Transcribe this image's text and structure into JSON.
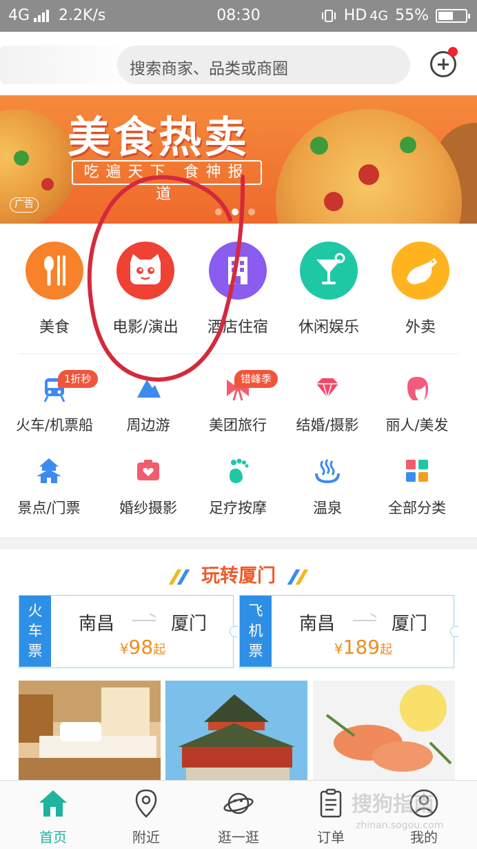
{
  "status_bar": {
    "network": "4G",
    "speed": "2.2K/s",
    "time": "08:30",
    "right_text": "HD",
    "network_right": "4G",
    "battery": "55%",
    "battery_level": 0.55
  },
  "search": {
    "placeholder": "搜索商家、品类或商圈"
  },
  "banner": {
    "title": "美食热卖",
    "subtitle": "吃遍天下 食神报道",
    "ad_label": "广告",
    "page_count": 3,
    "active_page": 2
  },
  "main_categories": [
    {
      "label": "美食",
      "icon": "fork-knife-icon",
      "color": "#f7822a"
    },
    {
      "label": "电影/演出",
      "icon": "cat-face-icon",
      "color": "#ef4134"
    },
    {
      "label": "酒店住宿",
      "icon": "building-icon",
      "color": "#8a5cf0"
    },
    {
      "label": "休闲娱乐",
      "icon": "cocktail-icon",
      "color": "#1ec8a5"
    },
    {
      "label": "外卖",
      "icon": "kangaroo-icon",
      "color": "#ffb41f"
    }
  ],
  "sub_categories": [
    {
      "label": "火车/机票船",
      "icon": "train-icon",
      "color": "#3d8bf0",
      "tag": "1折秒"
    },
    {
      "label": "周边游",
      "icon": "mountain-icon",
      "color": "#3d8bf0"
    },
    {
      "label": "美团旅行",
      "icon": "bow-icon",
      "color": "#f25c6c",
      "tag": "错峰季"
    },
    {
      "label": "结婚/摄影",
      "icon": "diamond-icon",
      "color": "#f2486a"
    },
    {
      "label": "丽人/美发",
      "icon": "woman-head-icon",
      "color": "#f25c7c"
    },
    {
      "label": "景点/门票",
      "icon": "temple-icon",
      "color": "#3d8bf0"
    },
    {
      "label": "婚纱摄影",
      "icon": "camera-icon",
      "color": "#f25c6c"
    },
    {
      "label": "足疗按摩",
      "icon": "footprint-icon",
      "color": "#1ec8a5"
    },
    {
      "label": "温泉",
      "icon": "hot-spring-icon",
      "color": "#3d8bf0"
    },
    {
      "label": "全部分类",
      "icon": "grid-icon",
      "color": "#f0a020"
    }
  ],
  "section": {
    "title": "玩转厦门"
  },
  "tickets": [
    {
      "type": "火车票",
      "from": "南昌",
      "to": "厦门",
      "currency": "¥",
      "price": "98",
      "suffix": "起"
    },
    {
      "type": "飞机票",
      "from": "南昌",
      "to": "厦门",
      "currency": "¥",
      "price": "189",
      "suffix": "起"
    }
  ],
  "bottom_nav": [
    {
      "label": "首页",
      "icon": "home-icon",
      "active": true
    },
    {
      "label": "附近",
      "icon": "location-pin-icon"
    },
    {
      "label": "逛一逛",
      "icon": "planet-icon"
    },
    {
      "label": "订单",
      "icon": "clipboard-icon"
    },
    {
      "label": "我的",
      "icon": "user-icon"
    }
  ],
  "watermark": {
    "text": "搜狗指南",
    "url_text": "zhinan.sogou.com"
  },
  "colors": {
    "accent": "#1fb3a0",
    "section_title": "#f05a2a",
    "price": "#f08c1e",
    "ticket_side": "#2e8fe6",
    "annotation": "#d42a3c"
  }
}
